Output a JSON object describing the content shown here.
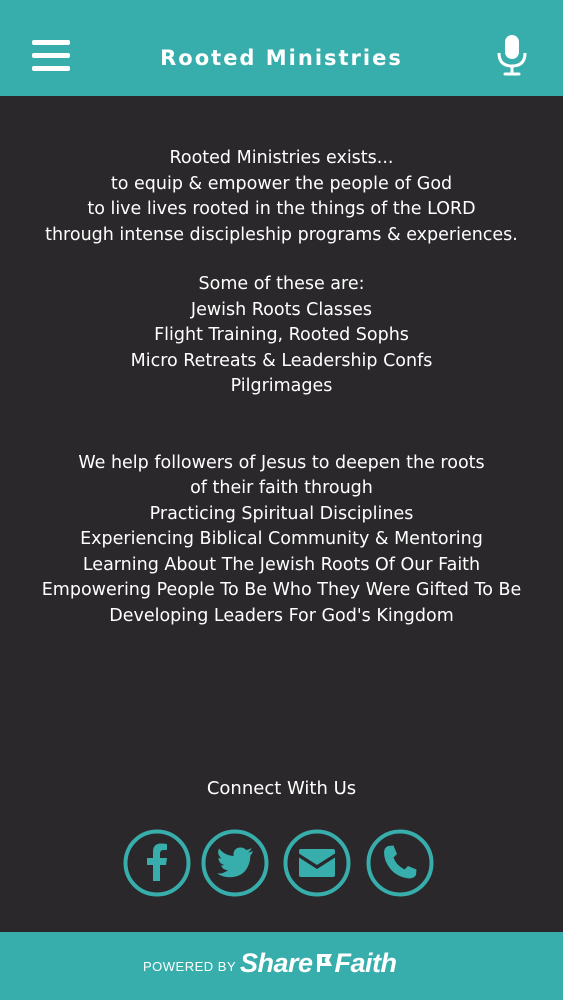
{
  "header": {
    "title": "Rooted Ministries"
  },
  "intro": [
    "Rooted Ministries exists...",
    "to equip & empower the people of God",
    "to live lives rooted in the things of the LORD",
    "through intense discipleship programs & experiences."
  ],
  "programs": [
    "Some of these are:",
    "Jewish Roots Classes",
    "Flight Training, Rooted Sophs",
    "Micro Retreats & Leadership Confs",
    "Pilgrimages"
  ],
  "help": [
    "We help followers of Jesus to deepen the roots",
    "of their faith through",
    "Practicing Spiritual Disciplines",
    "Experiencing Biblical Community & Mentoring",
    "Learning About The Jewish Roots Of Our Faith",
    "Empowering People To Be Who They Were Gifted To Be",
    "Developing Leaders For God's Kingdom"
  ],
  "connect": {
    "label": "Connect With Us"
  },
  "social_icons": [
    "facebook-icon",
    "twitter-icon",
    "email-icon",
    "phone-icon"
  ],
  "footer": {
    "powered_label": "POWERED BY",
    "brand_left": "Share",
    "brand_right": "Faith"
  },
  "colors": {
    "accent": "#37aeac",
    "background": "#2a282a",
    "text": "#ffffff"
  }
}
